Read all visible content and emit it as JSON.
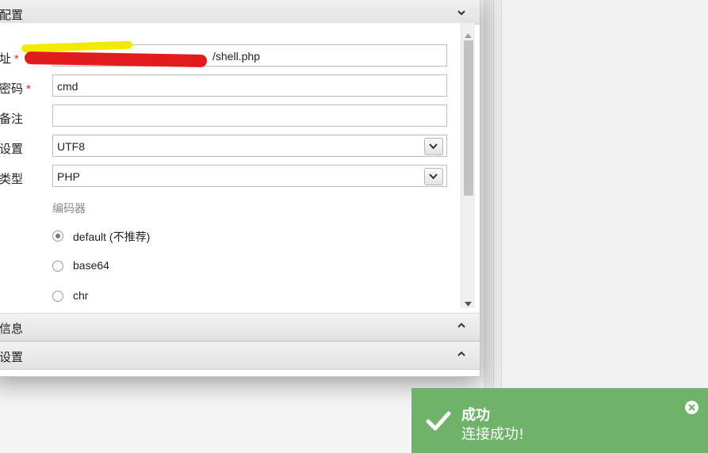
{
  "dialog": {
    "sections": {
      "basic": {
        "title": "配置"
      },
      "info": {
        "title": "信息"
      },
      "other": {
        "title": "设置"
      }
    },
    "fields": {
      "url": {
        "label": "址",
        "required_mark": "*",
        "value": "/shell.php"
      },
      "password": {
        "label": "密码",
        "required_mark": "*",
        "value": "cmd"
      },
      "note": {
        "label": "备注",
        "value": ""
      },
      "encoding": {
        "label": "设置",
        "value": "UTF8"
      },
      "type": {
        "label": "类型",
        "value": "PHP"
      }
    },
    "encoder": {
      "group_label": "编码器",
      "options": [
        {
          "label": "default (不推荐)",
          "checked": true
        },
        {
          "label": "base64",
          "checked": false
        },
        {
          "label": "chr",
          "checked": false
        }
      ]
    }
  },
  "toast": {
    "title": "成功",
    "message": "连接成功!",
    "color": "#6fb26a"
  },
  "icons": {
    "section_toggle_open": "chevron-down-icon",
    "section_toggle_closed": "chevron-up-icon",
    "select": "chevron-down-icon",
    "toast_status": "check-icon",
    "toast_close": "close-icon"
  }
}
